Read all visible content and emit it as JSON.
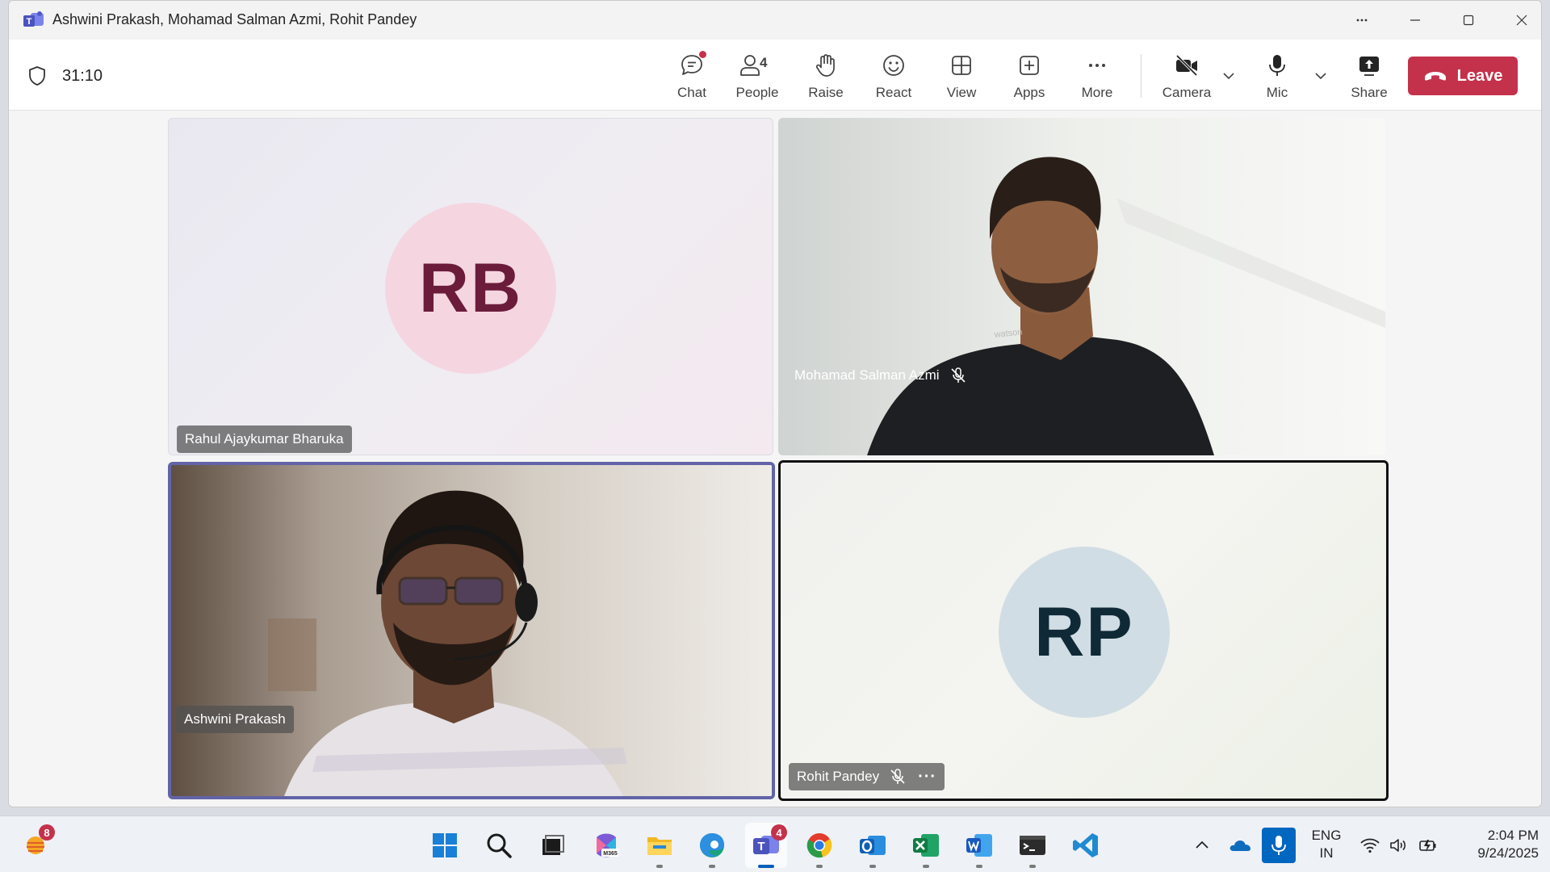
{
  "window": {
    "title": "Ashwini Prakash, Mohamad Salman Azmi, Rohit Pandey"
  },
  "meeting": {
    "timer": "31:10"
  },
  "toolbar": {
    "chat": "Chat",
    "people": "People",
    "people_count": "4",
    "raise": "Raise",
    "react": "React",
    "view": "View",
    "apps": "Apps",
    "more": "More",
    "camera": "Camera",
    "mic": "Mic",
    "share": "Share",
    "leave": "Leave"
  },
  "participants": [
    {
      "name": "Rahul Ajaykumar Bharuka",
      "initials": "RB",
      "video": false,
      "muted": false
    },
    {
      "name": "Mohamad Salman Azmi",
      "initials": "",
      "video": true,
      "muted": true
    },
    {
      "name": "Ashwini Prakash",
      "initials": "",
      "video": true,
      "muted": false,
      "selected": true
    },
    {
      "name": "Rohit Pandey",
      "initials": "RP",
      "video": false,
      "muted": true
    }
  ],
  "taskbar": {
    "weather_badge": "8",
    "teams_badge": "4",
    "apps": [
      "windows-start",
      "search",
      "task-view",
      "microsoft-365",
      "file-explorer",
      "edge",
      "teams",
      "chrome",
      "outlook",
      "excel",
      "word",
      "terminal",
      "vscode"
    ],
    "language_line1": "ENG",
    "language_line2": "IN",
    "time": "2:04 PM",
    "date": "9/24/2025"
  },
  "colors": {
    "leave": "#c4314b",
    "accent": "#6264a7",
    "taskbar_accent": "#0067c0"
  }
}
